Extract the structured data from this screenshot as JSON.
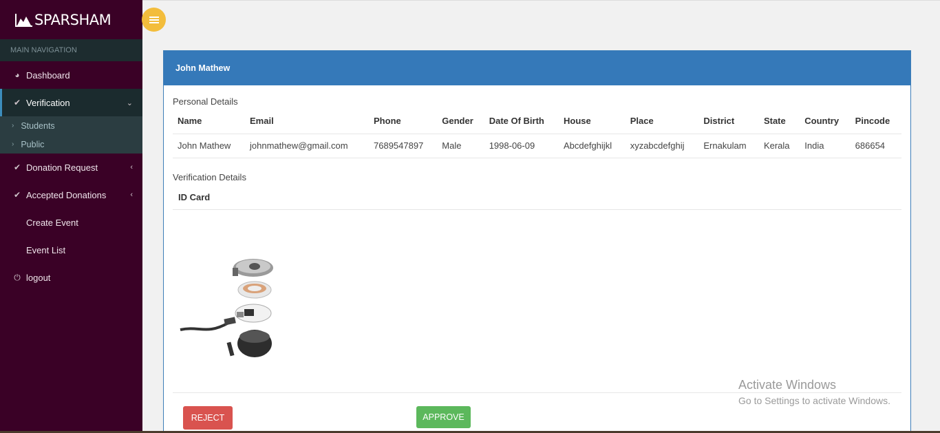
{
  "brand": {
    "name": "SPARSHAM"
  },
  "sidebar": {
    "header": "MAIN NAVIGATION",
    "items": [
      {
        "label": "Dashboard",
        "icon": "dashboard-icon"
      },
      {
        "label": "Verification",
        "icon": "check-icon",
        "active": true
      },
      {
        "label": "Donation Request",
        "icon": "check-icon"
      },
      {
        "label": "Accepted Donations",
        "icon": "check-icon"
      },
      {
        "label": "Create Event"
      },
      {
        "label": "Event List"
      },
      {
        "label": "logout",
        "icon": "power-icon"
      }
    ],
    "sub_items": [
      {
        "label": "Students"
      },
      {
        "label": "Public"
      }
    ]
  },
  "card": {
    "title": "John Mathew",
    "personal_title": "Personal Details",
    "columns": [
      "Name",
      "Email",
      "Phone",
      "Gender",
      "Date Of Birth",
      "House",
      "Place",
      "District",
      "State",
      "Country",
      "Pincode"
    ],
    "row": [
      "John Mathew",
      "johnmathew@gmail.com",
      "7689547897",
      "Male",
      "1998-06-09",
      "Abcdefghijkl",
      "xyzabcdefghij",
      "Ernakulam",
      "Kerala",
      "India",
      "686654"
    ],
    "verification_title": "Verification Details",
    "id_card_label": "ID Card"
  },
  "actions": {
    "reject": "REJECT",
    "approve": "APPROVE"
  },
  "watermark": {
    "line1": "Activate Windows",
    "line2": "Go to Settings to activate Windows."
  },
  "colors": {
    "sidebar": "#3a0126",
    "header": "#3579b9",
    "reject": "#d9534f",
    "approve": "#5cb85c",
    "toggle": "#f3bd3c"
  }
}
